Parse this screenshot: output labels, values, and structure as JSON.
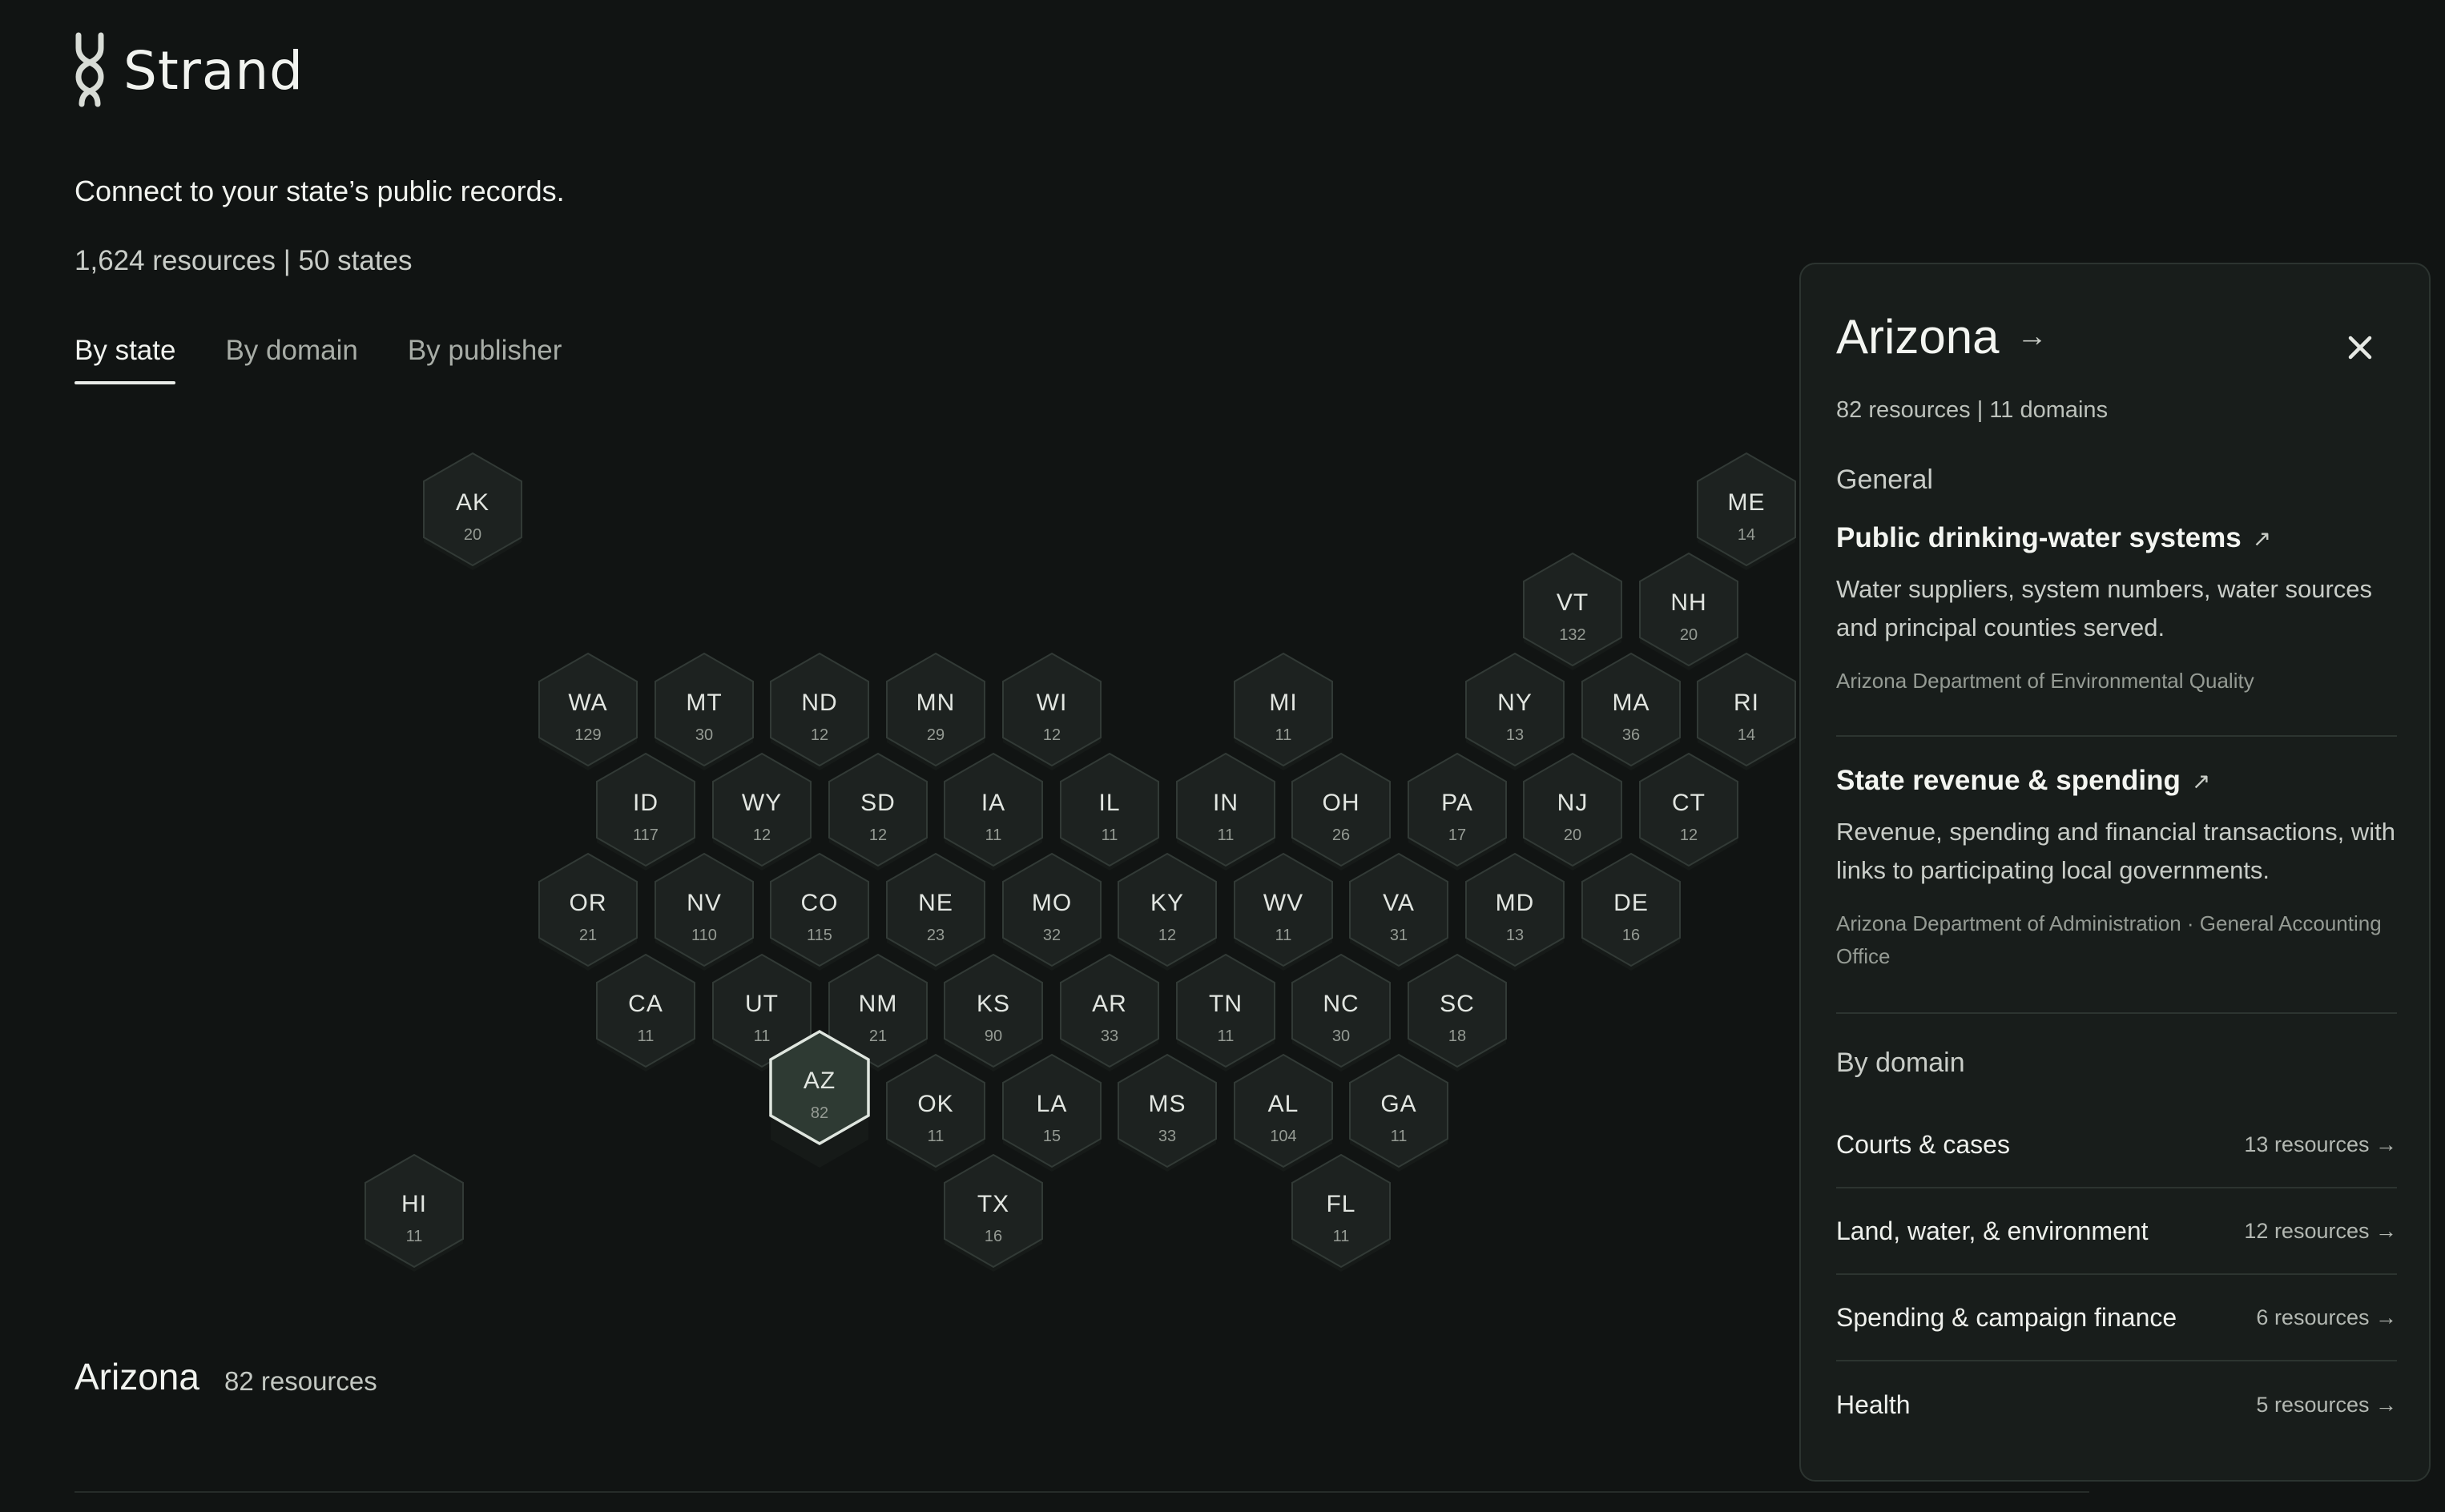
{
  "brand": {
    "name": "Strand"
  },
  "tagline": "Connect to your state’s public records.",
  "stats": "1,624 resources | 50 states",
  "tabs": [
    {
      "label": "By state",
      "active": true
    },
    {
      "label": "By domain",
      "active": false
    },
    {
      "label": "By publisher",
      "active": false
    }
  ],
  "selected_state": "AZ",
  "states": [
    {
      "code": "AK",
      "count": "20"
    },
    {
      "code": "ME",
      "count": "14"
    },
    {
      "code": "VT",
      "count": "132"
    },
    {
      "code": "NH",
      "count": "20"
    },
    {
      "code": "WA",
      "count": "129"
    },
    {
      "code": "MT",
      "count": "30"
    },
    {
      "code": "ND",
      "count": "12"
    },
    {
      "code": "MN",
      "count": "29"
    },
    {
      "code": "WI",
      "count": "12"
    },
    {
      "code": "MI",
      "count": "11"
    },
    {
      "code": "NY",
      "count": "13"
    },
    {
      "code": "MA",
      "count": "36"
    },
    {
      "code": "RI",
      "count": "14"
    },
    {
      "code": "ID",
      "count": "117"
    },
    {
      "code": "WY",
      "count": "12"
    },
    {
      "code": "SD",
      "count": "12"
    },
    {
      "code": "IA",
      "count": "11"
    },
    {
      "code": "IL",
      "count": "11"
    },
    {
      "code": "IN",
      "count": "11"
    },
    {
      "code": "OH",
      "count": "26"
    },
    {
      "code": "PA",
      "count": "17"
    },
    {
      "code": "NJ",
      "count": "20"
    },
    {
      "code": "CT",
      "count": "12"
    },
    {
      "code": "OR",
      "count": "21"
    },
    {
      "code": "NV",
      "count": "110"
    },
    {
      "code": "CO",
      "count": "115"
    },
    {
      "code": "NE",
      "count": "23"
    },
    {
      "code": "MO",
      "count": "32"
    },
    {
      "code": "KY",
      "count": "12"
    },
    {
      "code": "WV",
      "count": "11"
    },
    {
      "code": "VA",
      "count": "31"
    },
    {
      "code": "MD",
      "count": "13"
    },
    {
      "code": "DE",
      "count": "16"
    },
    {
      "code": "CA",
      "count": "11"
    },
    {
      "code": "UT",
      "count": "11"
    },
    {
      "code": "NM",
      "count": "21"
    },
    {
      "code": "KS",
      "count": "90"
    },
    {
      "code": "AR",
      "count": "33"
    },
    {
      "code": "TN",
      "count": "11"
    },
    {
      "code": "NC",
      "count": "30"
    },
    {
      "code": "SC",
      "count": "18"
    },
    {
      "code": "AZ",
      "count": "82"
    },
    {
      "code": "OK",
      "count": "11"
    },
    {
      "code": "LA",
      "count": "15"
    },
    {
      "code": "MS",
      "count": "33"
    },
    {
      "code": "AL",
      "count": "104"
    },
    {
      "code": "GA",
      "count": "11"
    },
    {
      "code": "HI",
      "count": "11"
    },
    {
      "code": "TX",
      "count": "16"
    },
    {
      "code": "FL",
      "count": "11"
    }
  ],
  "bottom": {
    "title": "Arizona",
    "count": "82 resources"
  },
  "panel": {
    "title": "Arizona",
    "title_arrow": "→",
    "subtitle": "82 resources | 11 domains",
    "general_heading": "General",
    "resources": [
      {
        "title": "Public drinking-water systems",
        "ext_icon": "↗",
        "description": "Water suppliers, system numbers, water sources and principal counties served.",
        "publisher": "Arizona Department of Environmental Quality"
      },
      {
        "title": "State revenue & spending",
        "ext_icon": "↗",
        "description": "Revenue, spending and financial transactions, with links to participating local governments.",
        "publisher": "Arizona Department of Administration · General Accounting Office"
      }
    ],
    "domain_heading": "By domain",
    "domains": [
      {
        "label": "Courts & cases",
        "count": "13 resources →"
      },
      {
        "label": "Land, water, & environment",
        "count": "12 resources →"
      },
      {
        "label": "Spending & campaign finance",
        "count": "6 resources →"
      },
      {
        "label": "Health",
        "count": "5 resources →"
      }
    ]
  },
  "colors": {
    "background": "#111413",
    "hex_fill": "#1d2220",
    "hex_selected": "#2e3a33",
    "panel": "#181d1b"
  }
}
